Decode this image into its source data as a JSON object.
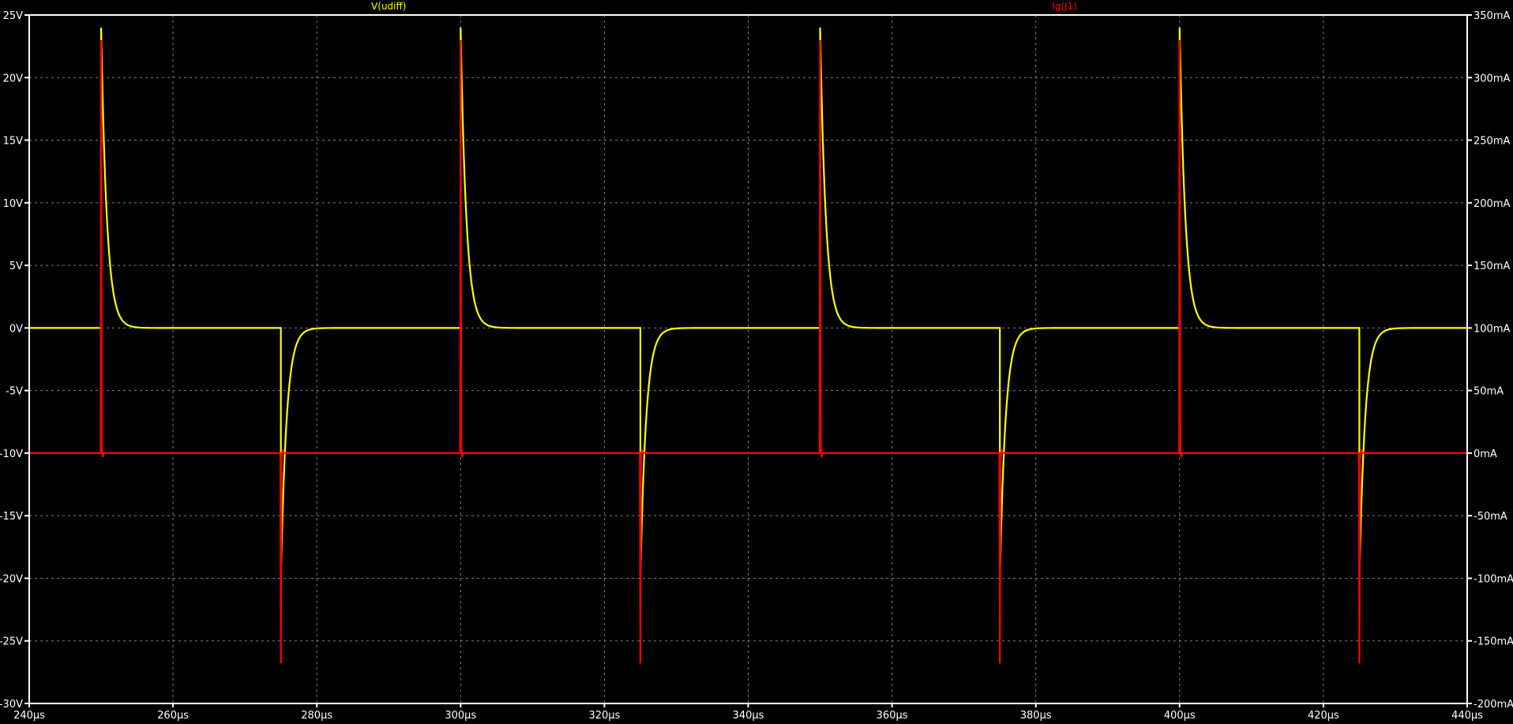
{
  "chart_data": {
    "type": "line",
    "background": "#000000",
    "axis_color": "#ffffff",
    "grid": true,
    "grid_color": "#7f7f7f",
    "x": {
      "label": "",
      "unit": "µs",
      "range": [
        240,
        440
      ],
      "ticks": [
        240,
        260,
        280,
        300,
        320,
        340,
        360,
        380,
        400,
        420,
        440
      ],
      "tick_labels": [
        "240µs",
        "260µs",
        "280µs",
        "300µs",
        "320µs",
        "340µs",
        "360µs",
        "380µs",
        "400µs",
        "420µs",
        "440µs"
      ]
    },
    "y_left": {
      "unit": "V",
      "range": [
        -30,
        25
      ],
      "ticks": [
        -30,
        -25,
        -20,
        -15,
        -10,
        -5,
        0,
        5,
        10,
        15,
        20,
        25
      ],
      "tick_labels": [
        "-30V",
        "-25V",
        "-20V",
        "-15V",
        "-10V",
        "-5V",
        "0V",
        "5V",
        "10V",
        "15V",
        "20V",
        "25V"
      ]
    },
    "y_right": {
      "unit": "mA",
      "range": [
        -200,
        350
      ],
      "ticks": [
        -200,
        -150,
        -100,
        -50,
        0,
        50,
        100,
        150,
        200,
        250,
        300,
        350
      ],
      "tick_labels": [
        "-200mA",
        "-150mA",
        "-100mA",
        "-50mA",
        "0mA",
        "50mA",
        "100mA",
        "150mA",
        "200mA",
        "250mA",
        "300mA",
        "350mA"
      ]
    },
    "series": [
      {
        "name": "V(udiff)",
        "color": "#ffff00",
        "axis": "left",
        "baseline": 0,
        "rising_edges_us": [
          250,
          300,
          350,
          400
        ],
        "falling_edges_us": [
          275,
          325,
          375,
          425
        ],
        "positive_peak_v": 24,
        "negative_peak_v": -20,
        "settle_time_constant_us": 0.8
      },
      {
        "name": "Ig(J1)",
        "color": "#ff0000",
        "axis": "right",
        "baseline_ma": 0,
        "positive_spikes": [
          {
            "x": 250,
            "peak_ma": 330
          },
          {
            "x": 300,
            "peak_ma": 330
          },
          {
            "x": 350,
            "peak_ma": 330
          },
          {
            "x": 400,
            "peak_ma": 330
          }
        ],
        "negative_spikes": [
          {
            "x": 275,
            "peak_ma": -168
          },
          {
            "x": 325,
            "peak_ma": -168
          },
          {
            "x": 375,
            "peak_ma": -168
          },
          {
            "x": 425,
            "peak_ma": -168
          }
        ]
      }
    ]
  }
}
